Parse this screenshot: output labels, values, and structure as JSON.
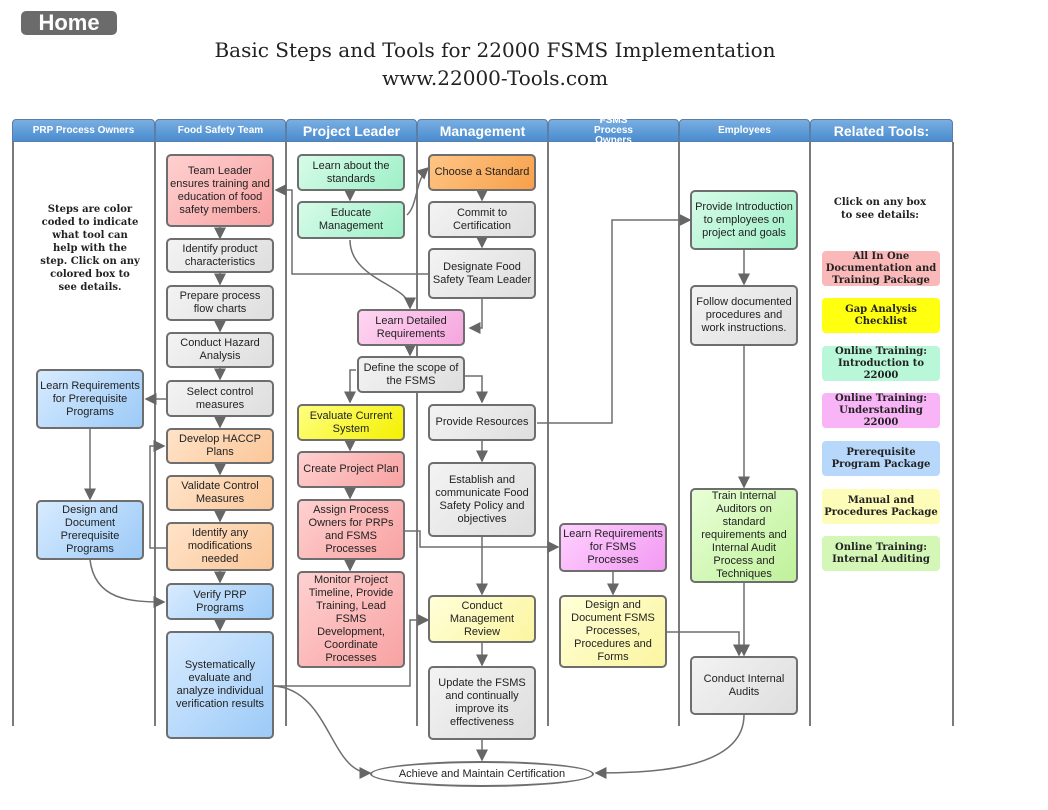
{
  "nav": {
    "home_label": "Home"
  },
  "header": {
    "title": "Basic Steps and Tools for 22000 FSMS Implementation",
    "subtitle": "www.22000-Tools.com"
  },
  "lanes": [
    {
      "label": "PRP Process Owners"
    },
    {
      "label": "Food Safety Team"
    },
    {
      "label": "Project Leader"
    },
    {
      "label": "Management"
    },
    {
      "label": "FSMS Process Owners"
    },
    {
      "label": "Employees"
    },
    {
      "label": "Related Tools:"
    }
  ],
  "legend_note": "Steps are color coded to indicate what tool can help with the step. Click on any colored box to see details.",
  "tools_note": "Click on any box to see details:",
  "tools": [
    {
      "label": "All In One Documentation and Training Package",
      "color": "#fbb3b3"
    },
    {
      "label": "Gap Analysis Checklist",
      "color": "#ffff00"
    },
    {
      "label": "Online Training: Introduction to 22000",
      "color": "#b6f7d8"
    },
    {
      "label": "Online Training: Understanding 22000",
      "color": "#f7b1f5"
    },
    {
      "label": "Prerequisite Program Package",
      "color": "#b6d8fb"
    },
    {
      "label": "Manual and Procedures Package",
      "color": "#fdfcb6"
    },
    {
      "label": "Online Training: Internal Auditing",
      "color": "#d2f7b6"
    }
  ],
  "steps": {
    "prp_learn": "Learn Requirements for Prerequisite Programs",
    "prp_design": "Design and Document Prerequisite Programs",
    "fst_team_leader": "Team Leader ensures training and education of food safety members.",
    "fst_identify": "Identify product characteristics",
    "fst_flow": "Prepare process flow charts",
    "fst_hazard": "Conduct Hazard Analysis",
    "fst_select": "Select control measures",
    "fst_haccp": "Develop HACCP Plans",
    "fst_validate": "Validate Control Measures",
    "fst_modify": "Identify any modifications needed",
    "fst_verify": "Verify PRP Programs",
    "fst_evaluate": "Systematically evaluate and analyze individual verification results",
    "pl_learn_std": "Learn about the standards",
    "pl_educate": "Educate Management",
    "pl_learn_detailed": "Learn Detailed Requirements",
    "pl_scope": "Define the scope of the FSMS",
    "pl_evaluate": "Evaluate Current System",
    "pl_plan": "Create Project Plan",
    "pl_assign": "Assign Process Owners for PRPs and FSMS Processes",
    "pl_monitor": "Monitor Project Timeline, Provide Training, Lead FSMS Development, Coordinate Processes",
    "mg_choose": "Choose a Standard",
    "mg_commit": "Commit to Certification",
    "mg_designate": "Designate Food Safety Team Leader",
    "mg_resources": "Provide Resources",
    "mg_policy": "Establish and communicate Food Safety Policy and objectives",
    "mg_review": "Conduct Management Review",
    "mg_update": "Update the FSMS and continually improve its effectiveness",
    "fp_learn": "Learn Requirements for FSMS Processes",
    "fp_design": "Design and Document FSMS Processes, Procedures and Forms",
    "em_intro": "Provide Introduction to employees on project and goals",
    "em_follow": "Follow documented procedures and work instructions.",
    "em_train": "Train Internal Auditors on standard requirements and Internal Audit Process and Techniques",
    "em_audits": "Conduct Internal Audits",
    "final": "Achieve and Maintain Certification"
  }
}
